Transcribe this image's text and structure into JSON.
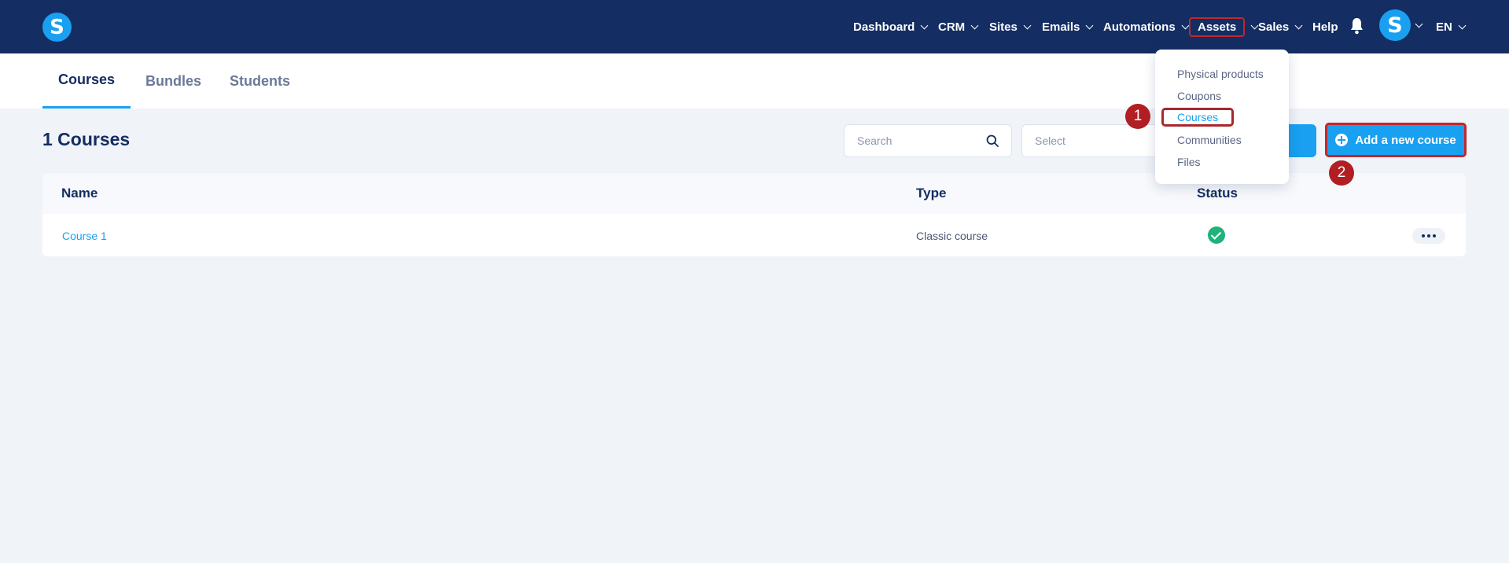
{
  "app": {
    "logo_letter": "S",
    "brand_color": "#1aa0f0",
    "nav_bg": "#142d62"
  },
  "nav": {
    "items": [
      {
        "label": "Dashboard",
        "has_chevron": true
      },
      {
        "label": "CRM",
        "has_chevron": true
      },
      {
        "label": "Sites",
        "has_chevron": true
      },
      {
        "label": "Emails",
        "has_chevron": true
      },
      {
        "label": "Automations",
        "has_chevron": true
      },
      {
        "label": "Assets",
        "has_chevron": true,
        "highlighted": true
      },
      {
        "label": "Sales",
        "has_chevron": true
      },
      {
        "label": "Help",
        "has_chevron": false
      }
    ],
    "bell_icon": "bell-icon",
    "avatar_letter": "S",
    "language": "EN"
  },
  "tabs": [
    {
      "label": "Courses",
      "active": true
    },
    {
      "label": "Bundles",
      "active": false
    },
    {
      "label": "Students",
      "active": false
    }
  ],
  "main": {
    "title": "1 Courses",
    "search_placeholder": "Search",
    "select_placeholder": "Select",
    "add_button_label": "Add a new course"
  },
  "table": {
    "columns": [
      "Name",
      "Type",
      "Status"
    ],
    "rows": [
      {
        "name": "Course 1",
        "type": "Classic course",
        "status": "active"
      }
    ]
  },
  "dropdown": {
    "items": [
      "Physical products",
      "Coupons",
      "Courses",
      "Communities",
      "Files"
    ],
    "selected": "Courses"
  },
  "markers": [
    "1",
    "2"
  ],
  "colors": {
    "highlight": "#c0282d",
    "success": "#1fb27a"
  }
}
